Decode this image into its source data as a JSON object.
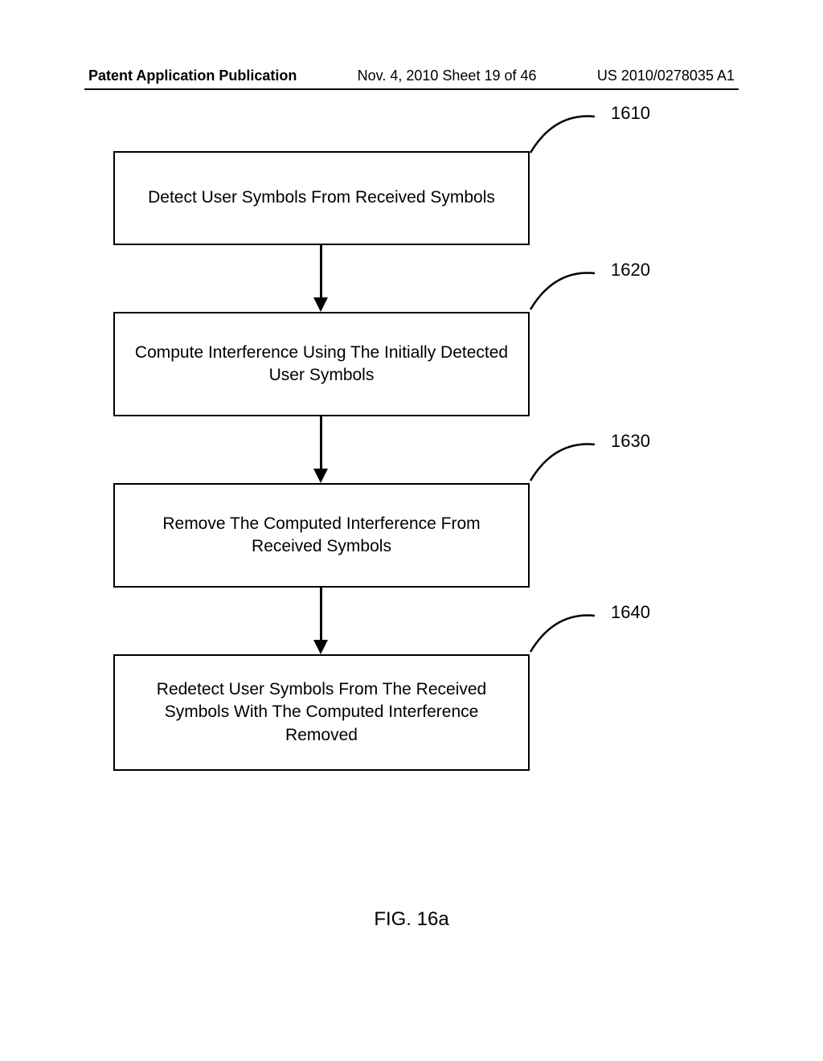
{
  "header": {
    "left": "Patent Application Publication",
    "mid": "Nov. 4, 2010  Sheet 19 of 46",
    "right": "US 2010/0278035 A1"
  },
  "chart_data": {
    "type": "flowchart",
    "nodes": [
      {
        "id": "1610",
        "label": "Detect User Symbols From Received Symbols"
      },
      {
        "id": "1620",
        "label": "Compute Interference Using The Initially Detected User Symbols"
      },
      {
        "id": "1630",
        "label": "Remove The Computed Interference From Received Symbols"
      },
      {
        "id": "1640",
        "label": "Redetect User Symbols From The Received Symbols With The Computed Interference Removed"
      }
    ],
    "edges": [
      {
        "from": "1610",
        "to": "1620"
      },
      {
        "from": "1620",
        "to": "1630"
      },
      {
        "from": "1630",
        "to": "1640"
      }
    ]
  },
  "boxes": {
    "b1": {
      "text": "Detect User Symbols From Received Symbols"
    },
    "b2": {
      "text": "Compute Interference Using The Initially Detected User Symbols"
    },
    "b3": {
      "text": "Remove The Computed Interference From Received Symbols"
    },
    "b4": {
      "text": "Redetect User Symbols From The Received Symbols With The Computed Interference Removed"
    }
  },
  "labels": {
    "l1": "1610",
    "l2": "1620",
    "l3": "1630",
    "l4": "1640"
  },
  "figure_caption": "FIG. 16a"
}
